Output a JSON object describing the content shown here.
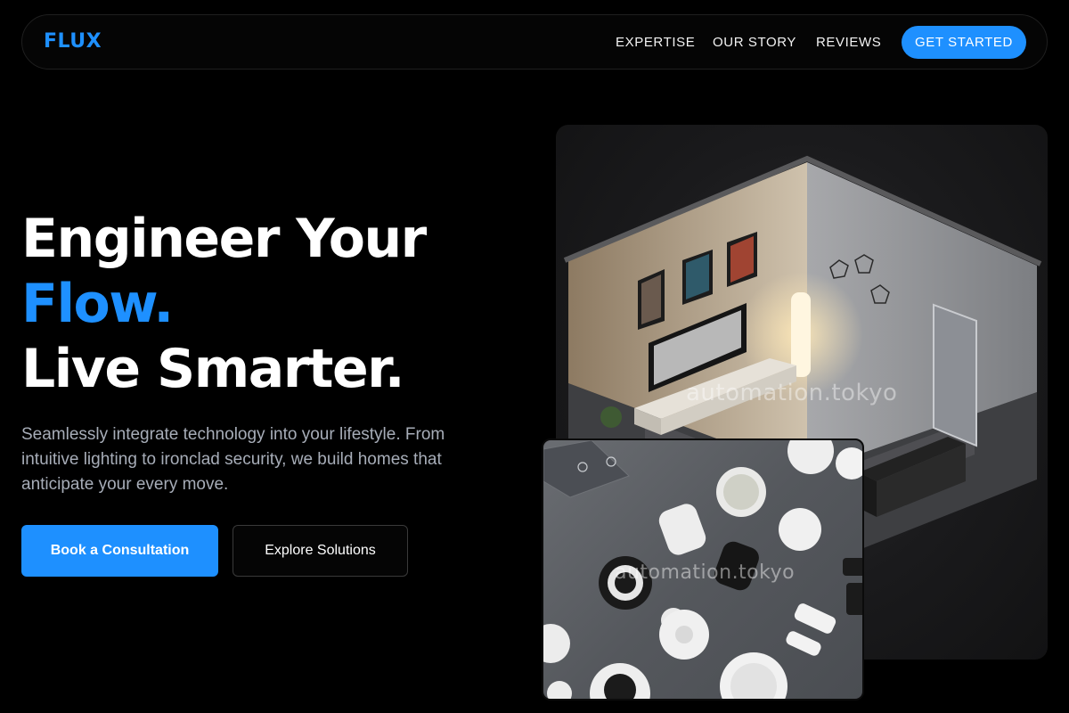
{
  "nav": {
    "logo": "FLUX",
    "links": [
      "EXPERTISE",
      "OUR STORY",
      "REVIEWS"
    ],
    "cta": "GET STARTED"
  },
  "hero": {
    "line1": "Engineer Your",
    "line2": "Flow.",
    "line3": "Live Smarter.",
    "description": "Seamlessly integrate technology into your lifestyle. From intuitive lighting to ironclad security, we build homes that anticipate your every move.",
    "primary_button": "Book a Consultation",
    "secondary_button": "Explore Solutions"
  },
  "images": {
    "room_watermark": "automation.tokyo",
    "devices_watermark": "automation.tokyo"
  },
  "colors": {
    "accent": "#1e90ff",
    "background": "#000000",
    "muted_text": "#a7adb8"
  }
}
